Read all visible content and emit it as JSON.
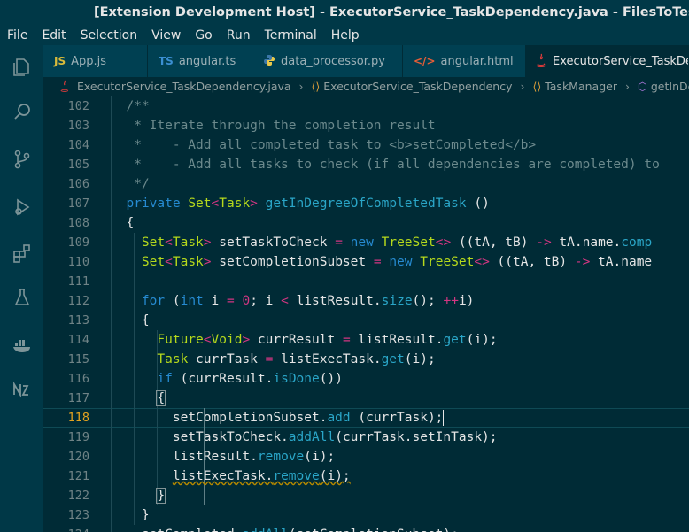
{
  "window": {
    "title": "[Extension Development Host] - ExecutorService_TaskDependency.java - FilesToTestTheme - V"
  },
  "menu": [
    "File",
    "Edit",
    "Selection",
    "View",
    "Go",
    "Run",
    "Terminal",
    "Help"
  ],
  "activity": [
    "explorer-icon",
    "search-icon",
    "source-control-icon",
    "debug-icon",
    "extensions-icon",
    "testing-icon",
    "docker-icon",
    "nx-icon"
  ],
  "tabs": [
    {
      "icon": "JS",
      "label": "App.js",
      "active": false
    },
    {
      "icon": "TS",
      "label": "angular.ts",
      "active": false
    },
    {
      "icon": "py",
      "label": "data_processor.py",
      "active": false
    },
    {
      "icon": "</>",
      "label": "angular.html",
      "active": false
    },
    {
      "icon": "java",
      "label": "ExecutorService_TaskDep",
      "active": true
    }
  ],
  "breadcrumb": [
    "ExecutorService_TaskDependency.java",
    "ExecutorService_TaskDependency",
    "TaskManager",
    "getInDegreeO"
  ],
  "editor": {
    "current_line": 118,
    "line_numbers": [
      "102",
      "103",
      "104",
      "105",
      "106",
      "107",
      "108",
      "109",
      "110",
      "111",
      "112",
      "113",
      "114",
      "115",
      "116",
      "117",
      "118",
      "119",
      "120",
      "121",
      "122",
      "123",
      "124"
    ]
  }
}
